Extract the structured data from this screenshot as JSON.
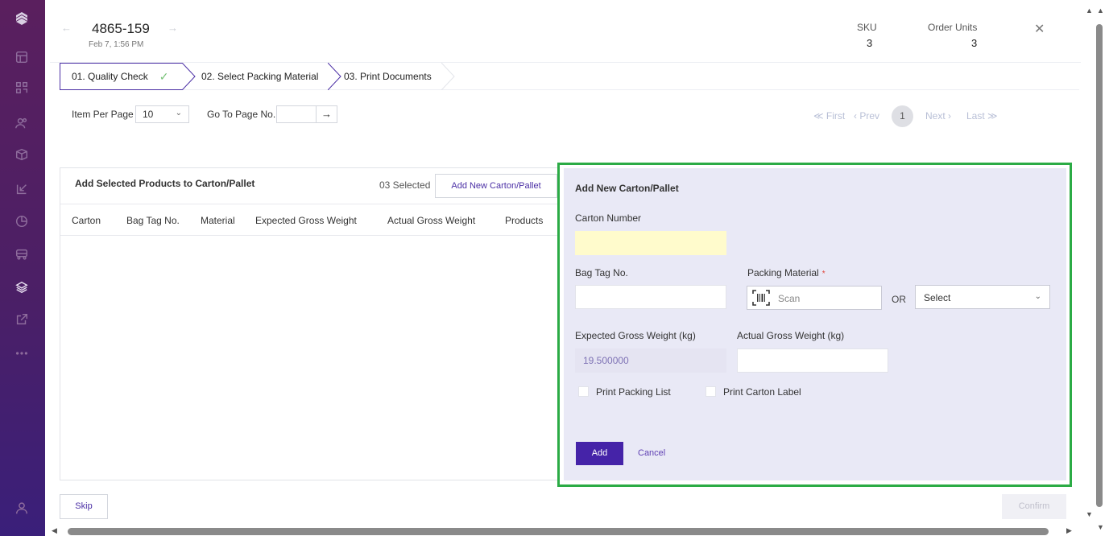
{
  "sidebar": {
    "icons": [
      "logo-icon",
      "layout-icon",
      "dashboard-icon",
      "users-icon",
      "box-icon",
      "import-icon",
      "chart-icon",
      "truck-icon",
      "layers-icon",
      "export-icon",
      "more-icon",
      "user-icon"
    ],
    "active": "layers-icon"
  },
  "header": {
    "order_id": "4865-159",
    "date": "Feb 7, 1:56 PM",
    "sku_label": "SKU",
    "sku_value": "3",
    "units_label": "Order Units",
    "units_value": "3",
    "back_arrow": "←",
    "forward_arrow": "→",
    "close_glyph": "✕"
  },
  "stepper": {
    "steps": [
      {
        "label": "01. Quality Check",
        "status": "done"
      },
      {
        "label": "02. Select Packing Material",
        "status": "active"
      },
      {
        "label": "03. Print Documents",
        "status": "pending"
      }
    ],
    "check_glyph": "✓"
  },
  "pager": {
    "items_label": "Item Per Page",
    "items_value": "10",
    "goto_label": "Go To Page No.",
    "goto_value": "",
    "go_glyph": "→",
    "first": "≪ First",
    "prev": "‹ Prev",
    "current": "1",
    "next": "Next ›",
    "last": "Last ≫"
  },
  "table": {
    "title": "Add Selected Products to Carton/Pallet",
    "selected": "03 Selected",
    "add_button": "Add New Carton/Pallet",
    "columns": [
      "Carton",
      "Bag Tag No.",
      "Material",
      "Expected Gross Weight",
      "Actual Gross Weight",
      "Products"
    ],
    "rows": []
  },
  "form": {
    "title": "Add New Carton/Pallet",
    "carton_number_label": "Carton Number",
    "carton_number_value": "",
    "bag_tag_label": "Bag Tag No.",
    "bag_tag_value": "",
    "packing_material_label": "Packing Material",
    "required_mark": "*",
    "scan_placeholder": "Scan",
    "or_text": "OR",
    "select_value": "Select",
    "expected_weight_label": "Expected Gross Weight (kg)",
    "expected_weight_value": "19.500000",
    "actual_weight_label": "Actual Gross Weight (kg)",
    "actual_weight_value": "",
    "print_packing_list": "Print Packing List",
    "print_packing_list_checked": false,
    "print_carton_label": "Print Carton Label",
    "print_carton_label_checked": false,
    "add_button": "Add",
    "cancel_link": "Cancel",
    "highlight_color": "#2bab45"
  },
  "footer": {
    "skip": "Skip",
    "confirm": "Confirm"
  },
  "colors": {
    "primary": "#4523a8",
    "sidebar_top": "#5a1f5e",
    "sidebar_bottom": "#3a1f7a"
  }
}
